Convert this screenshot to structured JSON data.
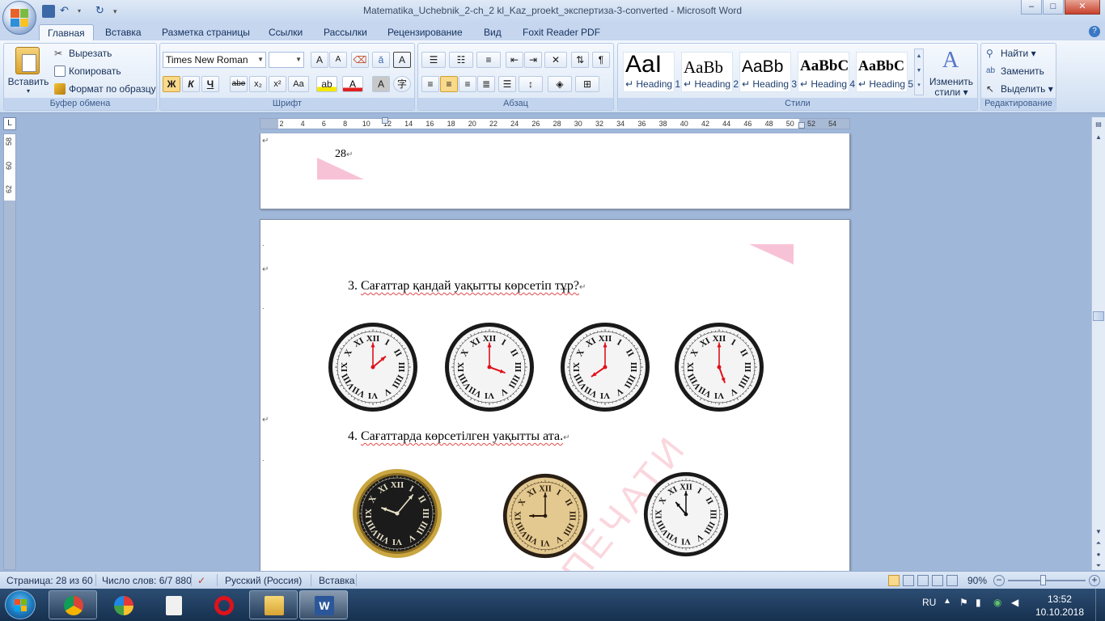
{
  "window": {
    "title": "Matematika_Uchebnik_2-ch_2 kl_Kaz_proekt_экспертиза-3-converted - Microsoft Word",
    "controls": [
      "–",
      "□",
      "✕"
    ]
  },
  "tabs": [
    "Главная",
    "Вставка",
    "Разметка страницы",
    "Ссылки",
    "Рассылки",
    "Рецензирование",
    "Вид",
    "Foxit Reader PDF"
  ],
  "ribbon": {
    "clipboard": {
      "paste_label": "Вставить",
      "cut_label": "Вырезать",
      "copy_label": "Копировать",
      "format_painter_label": "Формат по образцу",
      "group_label": "Буфер обмена"
    },
    "font": {
      "font_name": "Times New Roman",
      "font_size": "",
      "grow": "A",
      "shrink": "A",
      "bold": "Ж",
      "italic": "К",
      "underline": "Ч",
      "strike": "abe",
      "subscript": "x₂",
      "superscript": "x²",
      "change_case": "Aa",
      "group_label": "Шрифт"
    },
    "paragraph": {
      "group_label": "Абзац"
    },
    "styles": {
      "items": [
        {
          "sample": "AaI",
          "name": "Heading 1"
        },
        {
          "sample": "AaBb",
          "name": "Heading 2"
        },
        {
          "sample": "AaBb",
          "name": "Heading 3"
        },
        {
          "sample": "AaBbC",
          "name": "Heading 4"
        },
        {
          "sample": "AaBbC",
          "name": "Heading 5"
        }
      ],
      "change_styles_label_1": "Изменить",
      "change_styles_label_2": "стили",
      "group_label": "Стили"
    },
    "editing": {
      "find_label": "Найти",
      "replace_label": "Заменить",
      "select_label": "Выделить",
      "group_label": "Редактирование"
    }
  },
  "ruler": {
    "ticks": [
      "2",
      "4",
      "6",
      "8",
      "10",
      "12",
      "14",
      "16",
      "18",
      "20",
      "22",
      "24",
      "26",
      "28",
      "30",
      "32",
      "34",
      "36",
      "38",
      "40",
      "42",
      "44",
      "46",
      "48",
      "50",
      "52",
      "54"
    ]
  },
  "vruler": {
    "ticks": [
      "58",
      "60",
      "62"
    ]
  },
  "document": {
    "page_number": "28",
    "question_3": {
      "num": "3.",
      "text": "Сағаттар қандай уақытты көрсетіп тұр?"
    },
    "question_4": {
      "num": "4.",
      "text": "Сағаттарда көрсетілген уақытты ата."
    },
    "watermark": "ПЕЧАТИ"
  },
  "statusbar": {
    "page": "Страница: 28 из 60",
    "words": "Число слов: 6/7 880",
    "language": "Русский (Россия)",
    "mode": "Вставка",
    "zoom": "90%",
    "zoom_fraction": 0.45
  },
  "taskbar": {
    "lang": "RU",
    "time": "13:52",
    "date": "10.10.2018"
  },
  "colors": {
    "accent": "#2b579a",
    "hand_red": "#e0101a",
    "ribbon_bg": "#dde8f6"
  }
}
